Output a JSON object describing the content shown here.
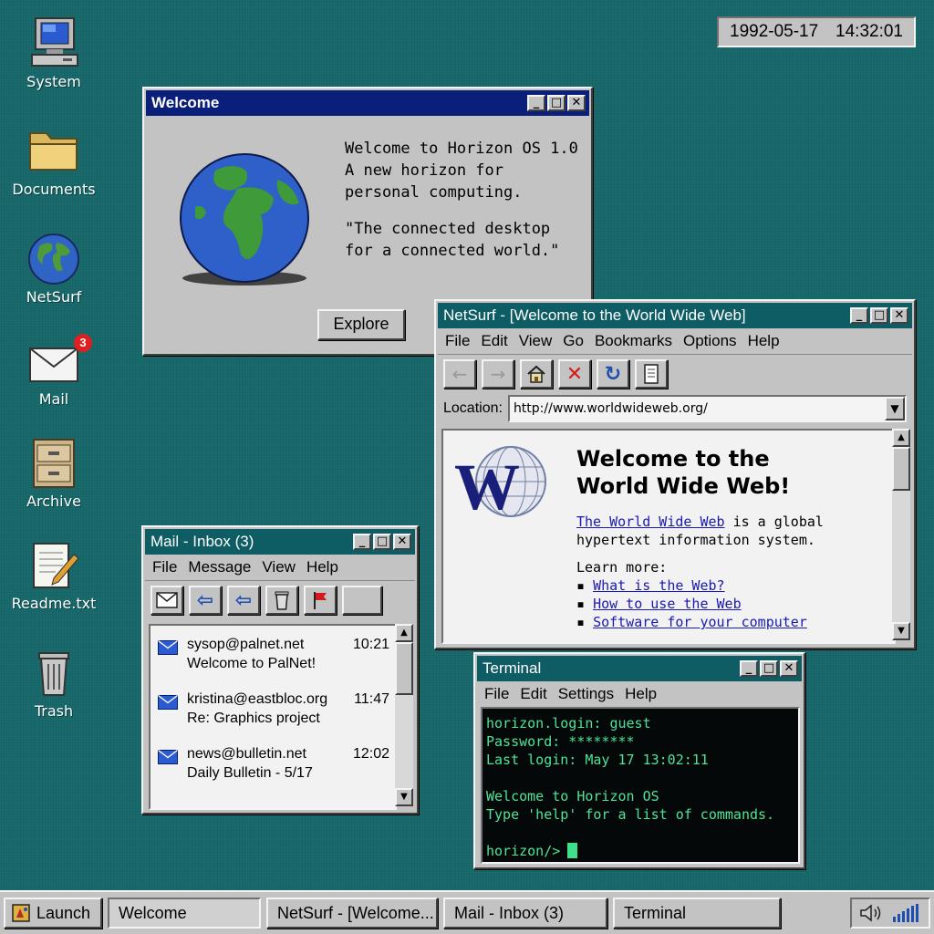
{
  "clock": {
    "date": "1992-05-17",
    "time": "14:32:01"
  },
  "desktop_icons": [
    {
      "label": "System",
      "icon": "computer-icon"
    },
    {
      "label": "Documents",
      "icon": "folder-icon"
    },
    {
      "label": "NetSurf",
      "icon": "globe-icon"
    },
    {
      "label": "Mail",
      "icon": "envelope-icon",
      "badge": "3"
    },
    {
      "label": "Archive",
      "icon": "filing-cabinet-icon"
    },
    {
      "label": "Readme.txt",
      "icon": "notepad-icon"
    },
    {
      "label": "Trash",
      "icon": "trash-icon"
    }
  ],
  "welcome": {
    "title": "Welcome",
    "lines": [
      "Welcome to Horizon OS 1.0",
      "A new horizon for",
      "personal computing."
    ],
    "quote": [
      "\"The connected desktop",
      "for a connected world.\""
    ],
    "button": "Explore"
  },
  "netsurf": {
    "title": "NetSurf - [Welcome to the World Wide Web]",
    "menu": [
      "File",
      "Edit",
      "View",
      "Go",
      "Bookmarks",
      "Options",
      "Help"
    ],
    "location_label": "Location:",
    "url": "http://www.worldwideweb.org/",
    "page": {
      "heading_line1": "Welcome to the",
      "heading_line2": "World Wide Web!",
      "intro_link": "The World Wide Web",
      "intro_rest": " is a global",
      "intro_line2": "hypertext information system.",
      "learn_more": "Learn more:",
      "links": [
        "What is the Web?",
        "How to use the Web",
        "Software for your computer"
      ]
    }
  },
  "mail": {
    "title": "Mail - Inbox (3)",
    "menu": [
      "File",
      "Message",
      "View",
      "Help"
    ],
    "messages": [
      {
        "from": "sysop@palnet.net",
        "time": "10:21",
        "subject": "Welcome to PalNet!"
      },
      {
        "from": "kristina@eastbloc.org",
        "time": "11:47",
        "subject": "Re: Graphics project"
      },
      {
        "from": "news@bulletin.net",
        "time": "12:02",
        "subject": "Daily Bulletin - 5/17"
      }
    ]
  },
  "terminal": {
    "title": "Terminal",
    "menu": [
      "File",
      "Edit",
      "Settings",
      "Help"
    ],
    "lines": [
      "horizon.login: guest",
      "Password: ********",
      "Last login: May 17 13:02:11",
      "",
      "Welcome to Horizon OS",
      "Type 'help' for a list of commands.",
      ""
    ],
    "prompt": "horizon/>"
  },
  "taskbar": {
    "launch": "Launch",
    "tasks": [
      "Welcome",
      "NetSurf - [Welcome...",
      "Mail - Inbox (3)",
      "Terminal"
    ]
  },
  "colors": {
    "desktop": "#196b6e",
    "title_active": "#0a1f7a",
    "title_inactive": "#0e5c64",
    "terminal_text": "#4fe39a"
  }
}
